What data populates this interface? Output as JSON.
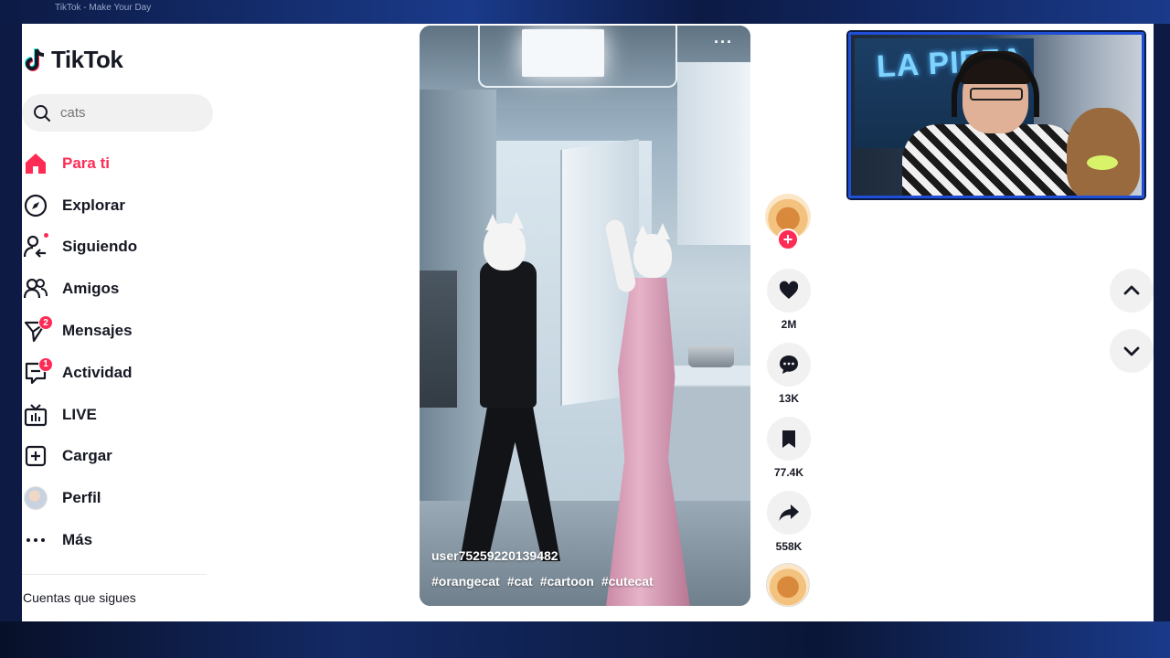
{
  "browser": {
    "tab_title": "TikTok - Make Your Day"
  },
  "sidebar": {
    "logo_text": "TikTok",
    "search": {
      "value": "",
      "placeholder": "cats"
    },
    "items": [
      {
        "label": "Para ti",
        "icon": "home-icon",
        "active": true
      },
      {
        "label": "Explorar",
        "icon": "compass-icon"
      },
      {
        "label": "Siguiendo",
        "icon": "following-icon",
        "dot": true
      },
      {
        "label": "Amigos",
        "icon": "friends-icon"
      },
      {
        "label": "Mensajes",
        "icon": "messages-icon",
        "badge": "2"
      },
      {
        "label": "Actividad",
        "icon": "activity-icon",
        "badge": "1"
      },
      {
        "label": "LIVE",
        "icon": "live-icon"
      },
      {
        "label": "Cargar",
        "icon": "upload-icon"
      },
      {
        "label": "Perfil",
        "icon": "avatar"
      },
      {
        "label": "Más",
        "icon": "more-icon"
      }
    ],
    "following_title": "Cuentas que sigues"
  },
  "video": {
    "username": "user75259220139482",
    "hashtags": [
      "#orangecat",
      "#cat",
      "#cartoon",
      "#cutecat"
    ],
    "more_label": "···"
  },
  "actions": {
    "follow_label": "+",
    "likes": "2M",
    "comments": "13K",
    "saves": "77.4K",
    "shares": "558K"
  },
  "webcam": {
    "poster_text": "LA PIEZA"
  },
  "colors": {
    "accent": "#fe2c55",
    "text": "#161823",
    "button_bg": "#f1f1f2",
    "frame": "#1f4fd6"
  }
}
